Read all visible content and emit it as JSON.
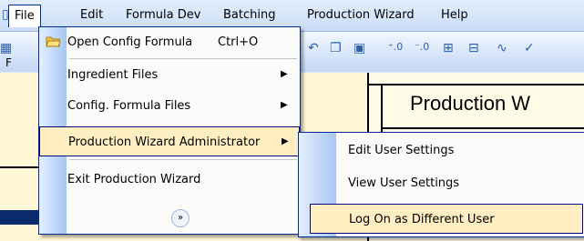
{
  "menubar": {
    "items": [
      {
        "label": "File"
      },
      {
        "label": "Edit"
      },
      {
        "label": "Formula Dev"
      },
      {
        "label": "Batching"
      },
      {
        "label": "Production Wizard"
      },
      {
        "label": "Help"
      }
    ]
  },
  "background": {
    "panel_title": "Production W",
    "left_letter": "F"
  },
  "file_menu": {
    "items": [
      {
        "label": "Open Config Formula",
        "shortcut": "Ctrl+O"
      },
      {
        "label": "Ingredient Files"
      },
      {
        "label": "Config. Formula Files"
      },
      {
        "label": "Production Wizard Administrator"
      },
      {
        "label": "Exit Production Wizard"
      }
    ],
    "expand_icon": "double-chevron-down"
  },
  "admin_submenu": {
    "items": [
      {
        "label": "Edit User Settings"
      },
      {
        "label": "View User Settings"
      },
      {
        "label": "Log On as Different User"
      }
    ]
  },
  "colors": {
    "menu_highlight": "#ffeec2",
    "menu_border": "#002d96",
    "gutter": "#a9c6f1"
  }
}
